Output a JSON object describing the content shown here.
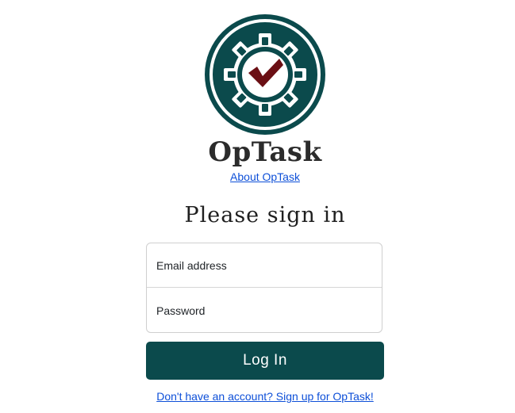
{
  "brand": {
    "name": "OpTask",
    "logo_icon": "gear-checkmark-icon",
    "colors": {
      "logo_teal": "#0b4a4c",
      "check_red": "#6b0f14"
    }
  },
  "links": {
    "about": "About OpTask",
    "signup": "Don't have an account? Sign up for OpTask!"
  },
  "signin": {
    "heading": "Please sign in",
    "email_label": "Email address",
    "password_label": "Password",
    "login_button": "Log In"
  },
  "colors": {
    "primary": "#0b4a4c",
    "link": "#0d4fd8"
  }
}
